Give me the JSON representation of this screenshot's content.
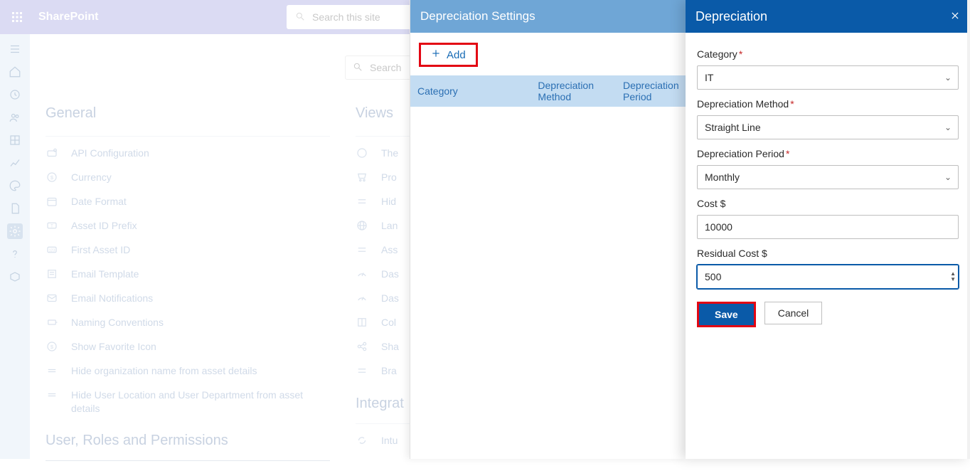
{
  "header": {
    "brand": "SharePoint",
    "search_placeholder": "Search this site"
  },
  "sub_search": {
    "placeholder": "Search"
  },
  "sections": {
    "general_title": "General",
    "general_items": [
      {
        "label": "API Configuration"
      },
      {
        "label": "Currency"
      },
      {
        "label": "Date Format"
      },
      {
        "label": "Asset ID Prefix"
      },
      {
        "label": "First Asset ID"
      },
      {
        "label": "Email Template"
      },
      {
        "label": "Email Notifications"
      },
      {
        "label": "Naming Conventions"
      },
      {
        "label": "Show Favorite Icon"
      },
      {
        "label": "Hide organization name from asset details"
      },
      {
        "label": "Hide User Location and User Department from asset details"
      }
    ],
    "user_roles_title": "User, Roles and Permissions",
    "views_title": "Views",
    "views_items": [
      {
        "label": "The"
      },
      {
        "label": "Pro"
      },
      {
        "label": "Hid"
      },
      {
        "label": "Lan"
      },
      {
        "label": "Ass"
      },
      {
        "label": "Das"
      },
      {
        "label": "Das"
      },
      {
        "label": "Col"
      },
      {
        "label": "Sha"
      },
      {
        "label": "Bra"
      }
    ],
    "integrations_title": "Integrat",
    "integrations_items": [
      {
        "label": "Intu"
      }
    ]
  },
  "mid_panel": {
    "title": "Depreciation Settings",
    "add_label": "Add",
    "cols": {
      "c1": "Category",
      "c2": "Depreciation Method",
      "c3": "Depreciation Period"
    }
  },
  "right_panel": {
    "title": "Depreciation",
    "labels": {
      "category": "Category",
      "method": "Depreciation Method",
      "period": "Depreciation Period",
      "cost": "Cost $",
      "residual": "Residual Cost $"
    },
    "values": {
      "category": "IT",
      "method": "Straight Line",
      "period": "Monthly",
      "cost": "10000",
      "residual": "500"
    },
    "buttons": {
      "save": "Save",
      "cancel": "Cancel"
    }
  }
}
